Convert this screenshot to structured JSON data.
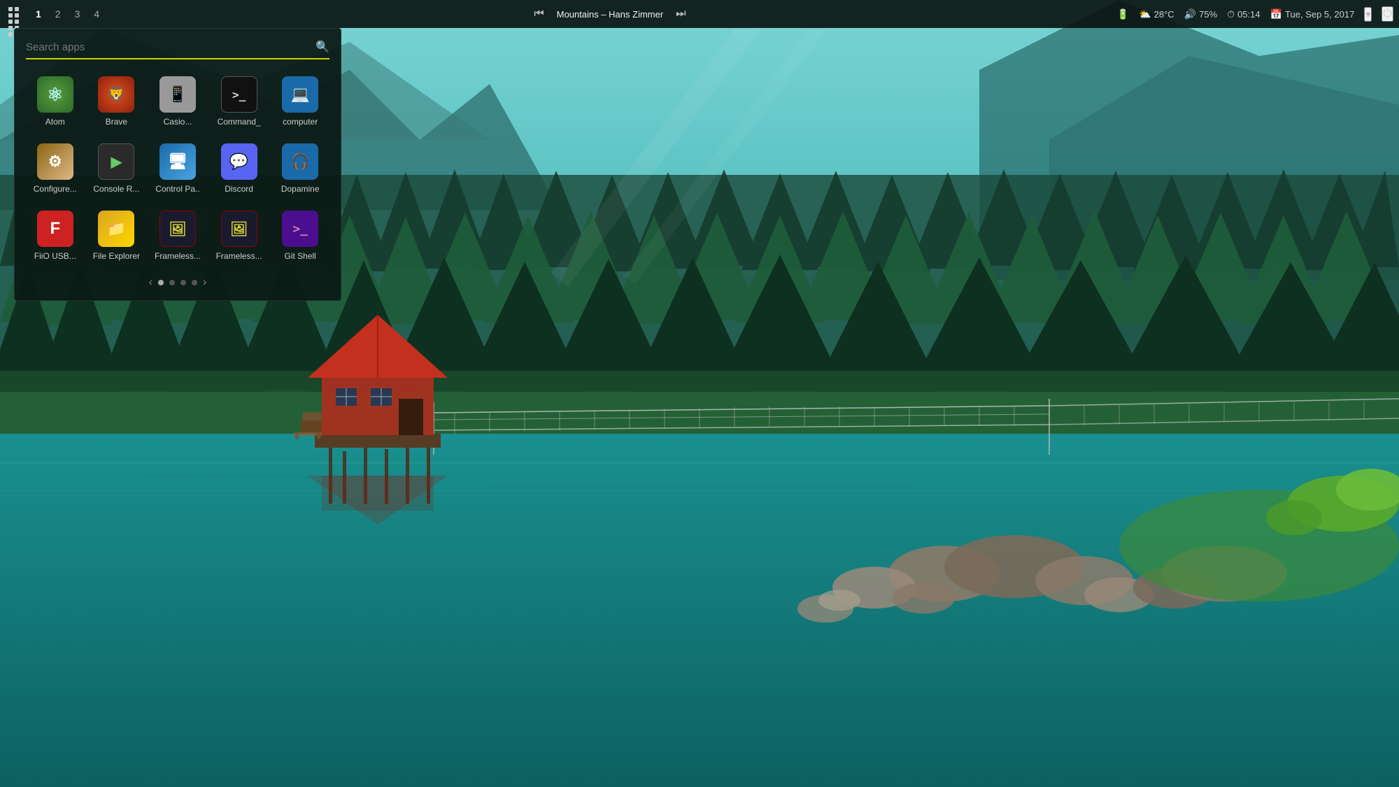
{
  "taskbar": {
    "workspaces": [
      "1",
      "2",
      "3",
      "4"
    ],
    "active_workspace": "1",
    "media": {
      "prev_label": "⏮",
      "next_label": "⏭",
      "song": "Mountains – Hans Zimmer"
    },
    "status": {
      "battery_icon": "🔋",
      "weather_icon": "⛅",
      "temperature": "28°C",
      "volume_icon": "🔊",
      "volume": "75%",
      "clock_icon": "⏱",
      "time": "05:14",
      "calendar_icon": "📅",
      "date": "Tue, Sep 5, 2017",
      "dropdown_icon": "▾",
      "power_icon": "⏻"
    }
  },
  "launcher": {
    "search_placeholder": "Search apps",
    "apps": [
      {
        "id": "atom",
        "label": "Atom",
        "icon_class": "atom-icon",
        "icon_text": "⚛"
      },
      {
        "id": "brave",
        "label": "Brave",
        "icon_class": "brave-icon",
        "icon_text": "🦁"
      },
      {
        "id": "casio",
        "label": "Casio...",
        "icon_class": "casio-icon",
        "icon_text": "📱"
      },
      {
        "id": "command",
        "label": "Command_",
        "icon_class": "command-icon",
        "icon_text": ">_"
      },
      {
        "id": "computer",
        "label": "computer",
        "icon_class": "computer-icon",
        "icon_text": "💻"
      },
      {
        "id": "configure",
        "label": "Configure...",
        "icon_class": "configure-icon",
        "icon_text": "⚙"
      },
      {
        "id": "console",
        "label": "Console R...",
        "icon_class": "console-icon",
        "icon_text": "▶"
      },
      {
        "id": "controlpa",
        "label": "Control Pa..",
        "icon_class": "controlpa-icon",
        "icon_text": "🖥"
      },
      {
        "id": "discord",
        "label": "Discord",
        "icon_class": "discord-icon",
        "icon_text": "💬"
      },
      {
        "id": "dopamine",
        "label": "Dopamine",
        "icon_class": "dopamine-icon",
        "icon_text": "🎧"
      },
      {
        "id": "fiio",
        "label": "FiiO USB...",
        "icon_class": "fiio-icon",
        "icon_text": "F"
      },
      {
        "id": "fileexp",
        "label": "File Explorer",
        "icon_class": "fileexp-icon",
        "icon_text": "📁"
      },
      {
        "id": "frameless1",
        "label": "Frameless...",
        "icon_class": "frameless1-icon",
        "icon_text": "🖼"
      },
      {
        "id": "frameless2",
        "label": "Frameless...",
        "icon_class": "frameless2-icon",
        "icon_text": "🖼"
      },
      {
        "id": "gitshell",
        "label": "Git Shell",
        "icon_class": "gitshell-icon",
        "icon_text": ">_"
      }
    ],
    "pagination": {
      "prev": "‹",
      "next": "›",
      "dots": [
        {
          "active": true
        },
        {
          "active": false
        },
        {
          "active": false
        },
        {
          "active": false
        }
      ]
    }
  }
}
